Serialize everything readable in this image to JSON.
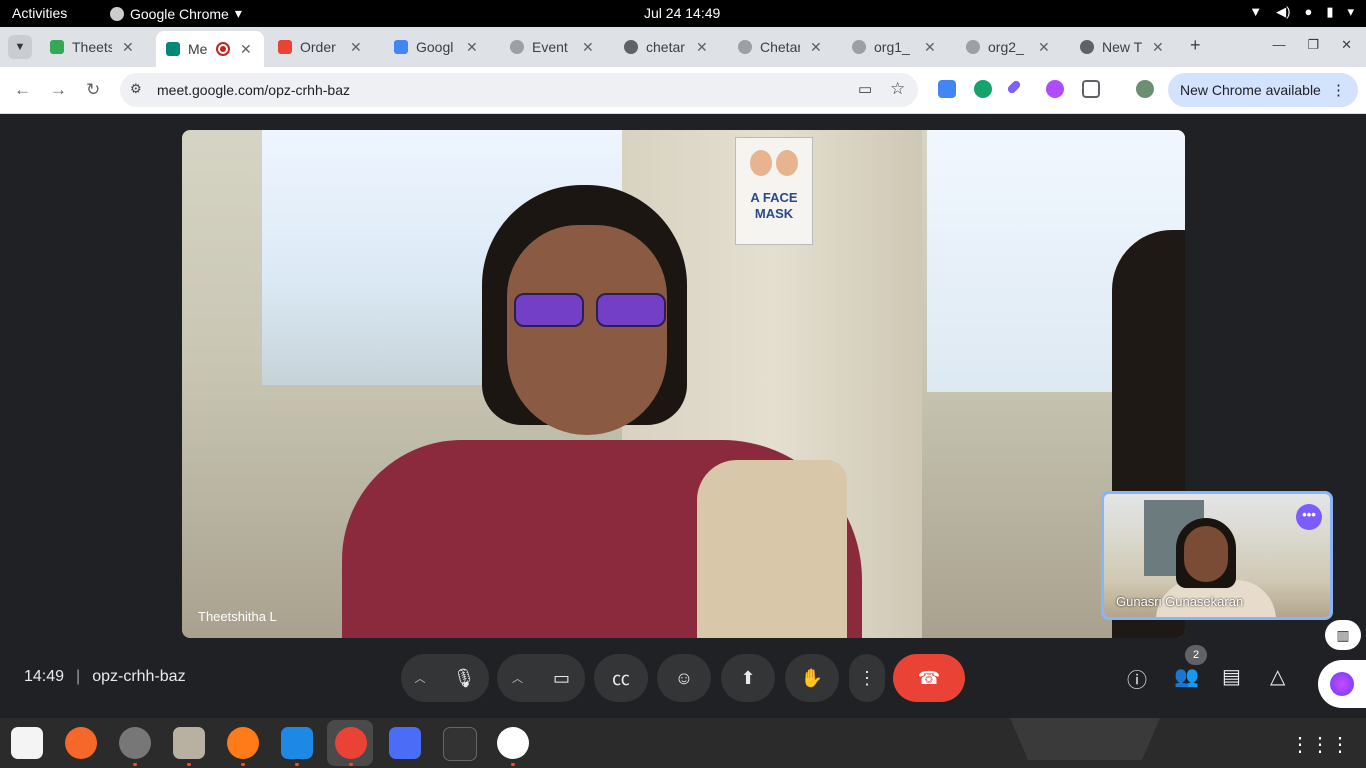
{
  "topbar": {
    "activities": "Activities",
    "app_name": "Google Chrome",
    "app_chevron": "▾",
    "datetime": "Jul 24  14:49"
  },
  "tabs": [
    {
      "title": "Theets",
      "favicon_color": "#34a853"
    },
    {
      "title": "Me",
      "favicon_color": "#00897b",
      "active": true,
      "recording": true
    },
    {
      "title": "Order",
      "favicon_color": "#ea4335"
    },
    {
      "title": "Googl",
      "favicon_color": "#4285f4"
    },
    {
      "title": "Event",
      "favicon_color": "#9aa0a6"
    },
    {
      "title": "chetar",
      "favicon_color": "#5f6368"
    },
    {
      "title": "Chetar",
      "favicon_color": "#9aa0a6"
    },
    {
      "title": "org1_",
      "favicon_color": "#9aa0a6"
    },
    {
      "title": "org2_",
      "favicon_color": "#9aa0a6"
    },
    {
      "title": "New T",
      "favicon_color": "#5f6368"
    }
  ],
  "toolbar": {
    "url": "meet.google.com/opz-crhh-baz",
    "new_chrome": "New Chrome available"
  },
  "meet": {
    "main_participant": "Theetshitha L",
    "self_participant": "Gunasri Gunasekaran",
    "time": "14:49",
    "meeting_code": "opz-crhh-baz",
    "people_count": "2",
    "colors": {
      "end_call": "#ea4335",
      "self_border": "#8ab4f8",
      "more_button": "#7c5cff"
    }
  },
  "icons": {
    "mic": "mic-icon",
    "camera": "camera-icon",
    "captions": "captions-icon",
    "emoji": "emoji-icon",
    "present": "present-icon",
    "hand": "raise-hand-icon",
    "more": "more-vert-icon",
    "end": "end-call-icon",
    "info": "info-icon",
    "people": "people-icon",
    "chat": "chat-icon",
    "activities": "activities-icon"
  }
}
